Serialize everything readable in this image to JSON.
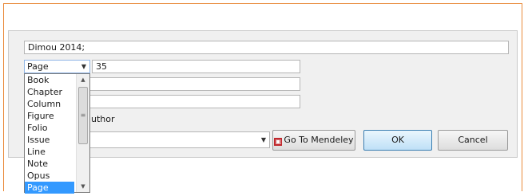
{
  "citation": {
    "text": "Dimou 2014;"
  },
  "locator": {
    "selected": "Page",
    "value": "35",
    "options": [
      "Book",
      "Chapter",
      "Column",
      "Figure",
      "Folio",
      "Issue",
      "Line",
      "Note",
      "Opus",
      "Page"
    ]
  },
  "author_option": {
    "label_partial": "uthor"
  },
  "buttons": {
    "mendeley": "Go To Mendeley",
    "ok": "OK",
    "cancel": "Cancel"
  },
  "icons": {
    "mendeley": "mendeley-logo-icon",
    "dropdown": "chevron-down-icon",
    "scroll_up": "chevron-up-icon",
    "scroll_down": "chevron-down-icon",
    "scroll_grip": "grip-icon"
  }
}
